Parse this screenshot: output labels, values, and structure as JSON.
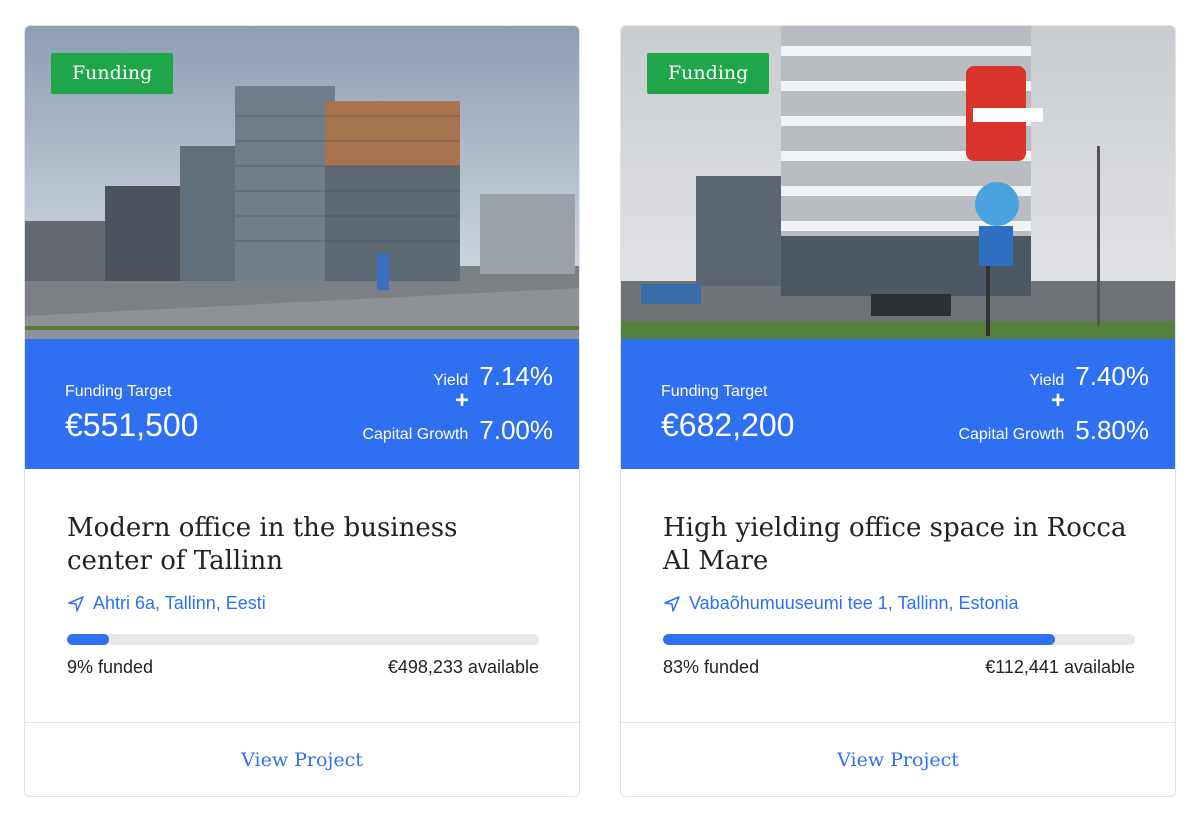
{
  "accent_color": "#2f6ff2",
  "badge_color": "#1fa64a",
  "projects": [
    {
      "status": "Funding",
      "funding_target_label": "Funding Target",
      "funding_target_value": "€551,500",
      "yield_label": "Yield",
      "yield_value": "7.14%",
      "plus": "+",
      "capital_growth_label": "Capital Growth",
      "capital_growth_value": "7.00%",
      "title": "Modern office in the business center of Tallinn",
      "location_icon": "navigation-arrow-icon",
      "location": "Ahtri 6a, Tallinn, Eesti",
      "funded_fraction": 0.09,
      "funded_text": "9% funded",
      "available_text": "€498,233 available",
      "button_label": "View Project"
    },
    {
      "status": "Funding",
      "funding_target_label": "Funding Target",
      "funding_target_value": "€682,200",
      "yield_label": "Yield",
      "yield_value": "7.40%",
      "plus": "+",
      "capital_growth_label": "Capital Growth",
      "capital_growth_value": "5.80%",
      "title": "High yielding office space in Rocca Al Mare",
      "location_icon": "navigation-arrow-icon",
      "location": "Vabaõhumuuseumi tee 1, Tallinn, Estonia",
      "funded_fraction": 0.83,
      "funded_text": "83% funded",
      "available_text": "€112,441 available",
      "button_label": "View Project"
    }
  ]
}
